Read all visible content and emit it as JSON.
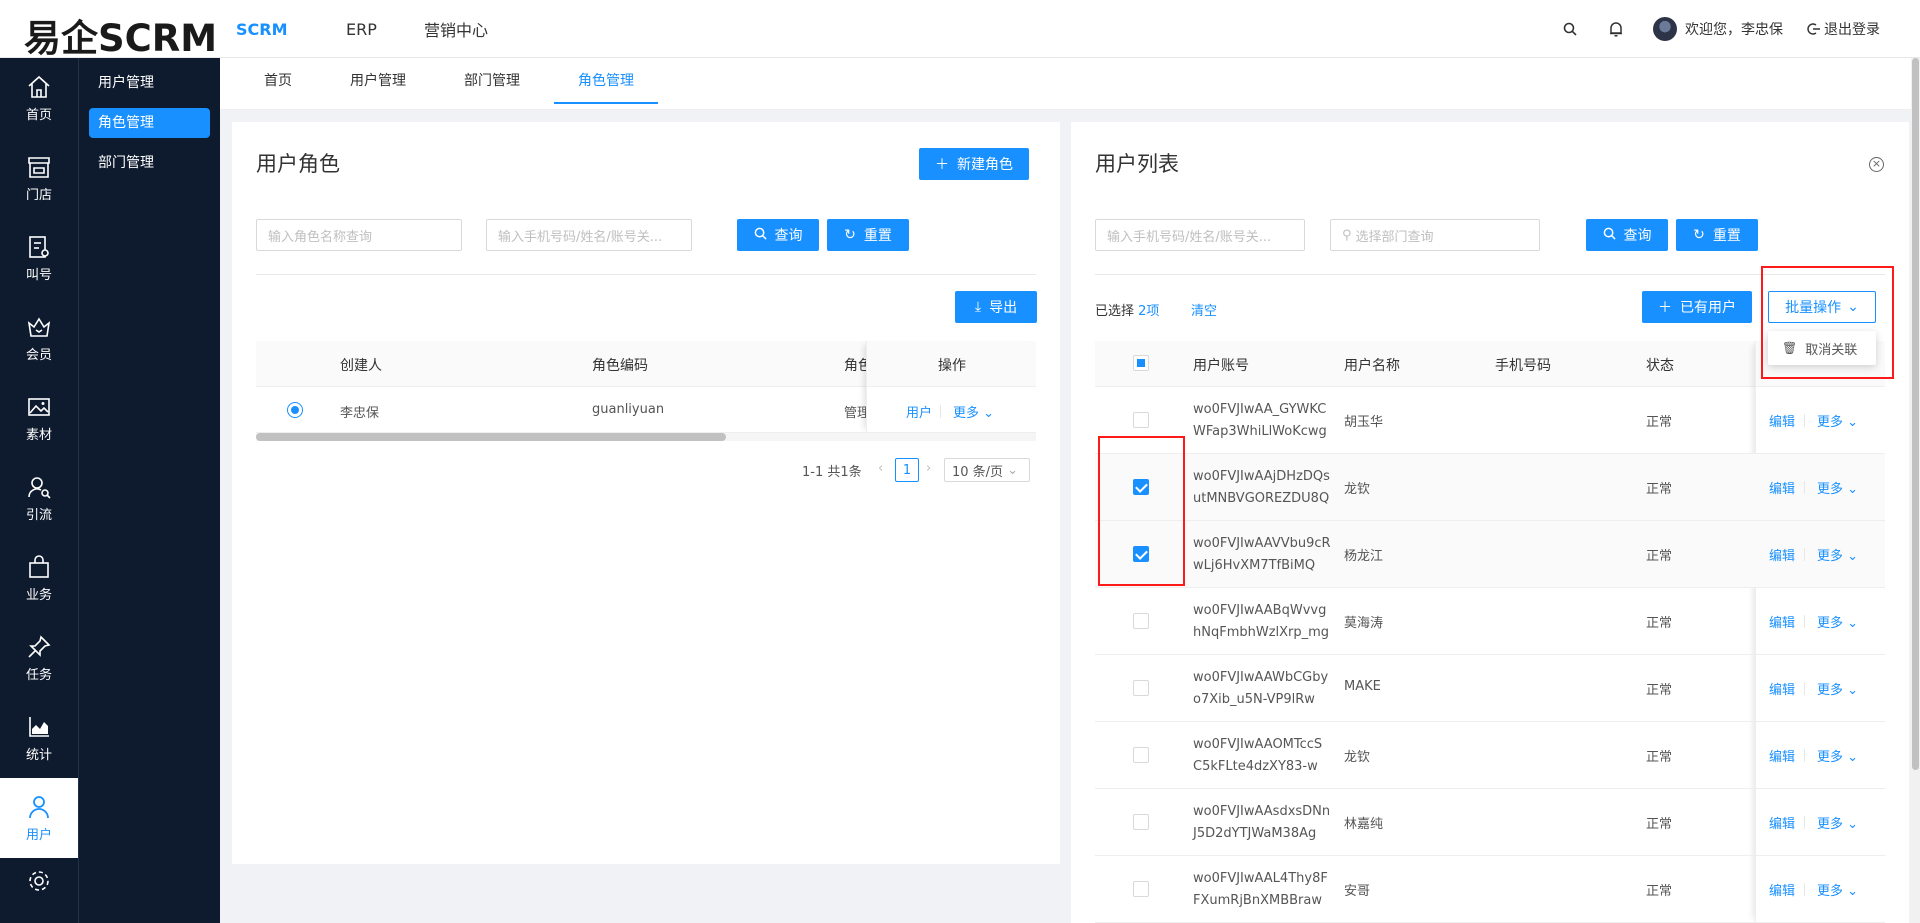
{
  "header": {
    "logo": "易企SCRM",
    "nav": [
      "SCRM",
      "ERP",
      "营销中心"
    ],
    "welcome": "欢迎您，李忠保",
    "logout": "退出登录"
  },
  "sidebar": {
    "items": [
      {
        "label": "首页",
        "icon": "home-icon"
      },
      {
        "label": "门店",
        "icon": "store-icon"
      },
      {
        "label": "叫号",
        "icon": "queue-icon"
      },
      {
        "label": "会员",
        "icon": "member-icon"
      },
      {
        "label": "素材",
        "icon": "image-icon"
      },
      {
        "label": "引流",
        "icon": "traffic-icon"
      },
      {
        "label": "业务",
        "icon": "bag-icon"
      },
      {
        "label": "任务",
        "icon": "pin-icon"
      },
      {
        "label": "统计",
        "icon": "chart-icon"
      },
      {
        "label": "用户",
        "icon": "user-icon"
      }
    ]
  },
  "submenu": [
    "用户管理",
    "角色管理",
    "部门管理"
  ],
  "tabs": [
    "首页",
    "用户管理",
    "部门管理",
    "角色管理"
  ],
  "roles_panel": {
    "title": "用户角色",
    "new_button": "新建角色",
    "role_search_placeholder": "输入角色名称查询",
    "user_search_placeholder": "输入手机号码/姓名/账号关...",
    "query_button": "查询",
    "reset_button": "重置",
    "export_button": "导出",
    "columns": [
      "创建人",
      "角色编码",
      "角色",
      "操作"
    ],
    "rows": [
      {
        "creator": "李忠保",
        "code": "guanliyuan",
        "role": "管理",
        "action_users": "用户",
        "action_more": "更多"
      }
    ],
    "pager": {
      "summary": "1-1 共1条",
      "page": "1",
      "page_size": "10 条/页"
    }
  },
  "users_panel": {
    "title": "用户列表",
    "search_placeholder": "输入手机号码/姓名/账号关...",
    "dept_placeholder": "选择部门查询",
    "query_button": "查询",
    "reset_button": "重置",
    "selected_prefix": "已选择",
    "selected_count": "2项",
    "clear": "清空",
    "existing_user_button": "已有用户",
    "batch_button": "批量操作",
    "batch_menu_item": "取消关联",
    "columns": [
      "用户账号",
      "用户名称",
      "手机号码",
      "状态"
    ],
    "edit_label": "编辑",
    "more_label": "更多",
    "rows": [
      {
        "account1": "wo0FVJIwAA_GYWKC",
        "account2": "WFap3WhiLlWoKcwg",
        "name": "胡玉华",
        "status": "正常",
        "checked": false
      },
      {
        "account1": "wo0FVJIwAAjDHzDQs",
        "account2": "utMNBVGOREZDU8Q",
        "name": "龙钦",
        "status": "正常",
        "checked": true
      },
      {
        "account1": "wo0FVJIwAAVVbu9cR",
        "account2": "wLj6HvXM7TfBiMQ",
        "name": "杨龙江",
        "status": "正常",
        "checked": true
      },
      {
        "account1": "wo0FVJIwAABqWvvg",
        "account2": "hNqFmbhWzlXrp_mg",
        "name": "莫海涛",
        "status": "正常",
        "checked": false
      },
      {
        "account1": "wo0FVJIwAAWbCGby",
        "account2": "o7Xib_u5N-VP9lRw",
        "name": "MAKE",
        "status": "正常",
        "checked": false
      },
      {
        "account1": "wo0FVJIwAAOMTccS",
        "account2": "C5kFLte4dzXY83-w",
        "name": "龙钦",
        "status": "正常",
        "checked": false
      },
      {
        "account1": "wo0FVJIwAAsdxsDNn",
        "account2": "J5D2dYTJWaM38Ag",
        "name": "林嘉纯",
        "status": "正常",
        "checked": false
      },
      {
        "account1": "wo0FVJIwAAL4Thy8F",
        "account2": "FXumRjBnXMBBraw",
        "name": "安哥",
        "status": "正常",
        "checked": false
      }
    ]
  },
  "colors": {
    "primary": "#1890ff",
    "sidebar": "#0e1b2e",
    "highlight": "#ff1a1a"
  }
}
